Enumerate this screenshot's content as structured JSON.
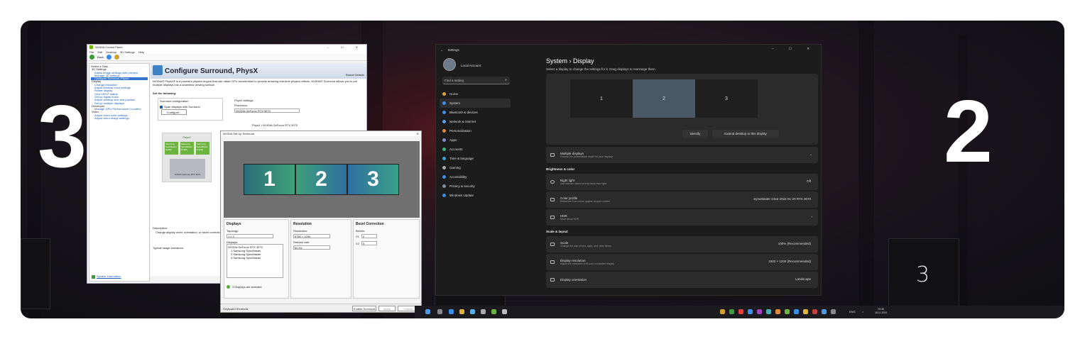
{
  "labels": {
    "left_big": "3",
    "center_big": "1",
    "right_big": "2",
    "box_mid": "2",
    "box_right": "3"
  },
  "nvidia_panel": {
    "title": "NVIDIA Control Panel",
    "menu": [
      "File",
      "Edit",
      "Desktop",
      "3D Settings",
      "Help"
    ],
    "back_label": "Back",
    "task_label": "Select a Task...",
    "tree": [
      "3D Settings",
      "Adjust image settings with preview",
      "Manage 3D settings",
      "Configure Surround, PhysX",
      "Display",
      "Change resolution",
      "Adjust desktop color settings",
      "Rotate display",
      "View HDCP status",
      "Set up digital audio",
      "Adjust desktop size and position",
      "Set up multiple displays",
      "Developer",
      "Manage GPU Performance Counters",
      "Video",
      "Adjust video color settings",
      "Adjust video image settings"
    ],
    "header": "Configure Surround, PhysX",
    "restore": "Restore Defaults",
    "intro": "NVIDIA® PhysX® is a powerful physics engine that can utilize GPU acceleration to provide amazing real-time physics effects. NVIDIA® Surround allows you to put multiple displays into a seamless viewing surface.",
    "set_following": "Set the following:",
    "surround_config": "Surround configuration",
    "span_label": "Span displays with Surround",
    "configure_btn": "Configure...",
    "physx_settings": "PhysX settings",
    "processor_label": "Processor:",
    "processor_value": "NVIDIA GeForce RTX 3070",
    "physx_caption": "PhysX • NVIDIA GeForce RTX 3070",
    "diagram_physx": "PhysX",
    "diagram_gpu": "NVIDIA GeForce RTX 3070",
    "diagram_mon": "Samsung SyncMaster (FullD)",
    "description_label": "Description:",
    "description_text": "Change display order, orientation, or bezel correction.",
    "typical_label": "Typical usage scenarios:",
    "system_info": "System Information"
  },
  "surround_dialog": {
    "title": "NVIDIA Set Up Surround",
    "monitors": [
      "1",
      "2",
      "3"
    ],
    "displays_title": "Displays",
    "topology_label": "Topology:",
    "topology_value": "1 x 3",
    "displays_label": "Displays:",
    "display_list": [
      "NVIDIA GeForce RTX 3070",
      "1.Samsung SyncMaster",
      "2.Samsung SyncMaster",
      "3.Samsung SyncMaster"
    ],
    "status": "3 Displays are selected.",
    "resolution_title": "Resolution",
    "resolution_label": "Resolution:",
    "resolution_value": "5760 × 1200",
    "refresh_label": "Refresh rate:",
    "refresh_value": "60 Hz",
    "bezel_title": "Bezel Correction",
    "bezels_label": "Bezels:",
    "bezel_values": [
      "0",
      "0"
    ],
    "bezel_keys": [
      "V1",
      "V2"
    ],
    "shortcuts": "Keyboard Shortcuts",
    "enable": "Enable Surround",
    "apply": "Apply",
    "cancel": "Cancel"
  },
  "settings": {
    "title": "Settings",
    "account": "Local Account",
    "search_placeholder": "Find a setting",
    "nav": [
      {
        "label": "Home",
        "color": "#e0a040"
      },
      {
        "label": "System",
        "color": "#3a8ee6"
      },
      {
        "label": "Bluetooth & devices",
        "color": "#3a8ee6"
      },
      {
        "label": "Network & internet",
        "color": "#5aa0e8"
      },
      {
        "label": "Personalization",
        "color": "#e08840"
      },
      {
        "label": "Apps",
        "color": "#8888cc"
      },
      {
        "label": "Accounts",
        "color": "#40b080"
      },
      {
        "label": "Time & language",
        "color": "#3aa0d0"
      },
      {
        "label": "Gaming",
        "color": "#aaaaaa"
      },
      {
        "label": "Accessibility",
        "color": "#4090e0"
      },
      {
        "label": "Privacy & security",
        "color": "#8090a0"
      },
      {
        "label": "Windows Update",
        "color": "#3a8ee6"
      }
    ],
    "breadcrumb": "System  ›  Display",
    "hint": "Select a display to change the settings for it. Drag displays to rearrange them.",
    "monitors": [
      "1",
      "2",
      "3"
    ],
    "identify": "Identify",
    "extend": "Extend desktop to this display",
    "multiple": {
      "title": "Multiple displays",
      "sub": "Choose the presentation mode for your displays"
    },
    "brightness_section": "Brightness & color",
    "night": {
      "title": "Night light",
      "sub": "Use warmer colors to help block blue light",
      "value": "Off"
    },
    "color_profile": {
      "title": "Color profile",
      "sub": "Determine how colors appear on your screen",
      "value": "SyncMaster 2443 2022-01-20 RTX 3070"
    },
    "hdr": {
      "title": "HDR",
      "sub": "More about HDR"
    },
    "scale_section": "Scale & layout",
    "scale": {
      "title": "Scale",
      "sub": "Change the size of text, apps, and other items",
      "value": "100% (Recommended)"
    },
    "resolution": {
      "title": "Display resolution",
      "sub": "Adjust the resolution to fit your connected display",
      "value": "1920 × 1200 (Recommended)"
    },
    "orientation": {
      "title": "Display orientation",
      "value": "Landscape"
    }
  },
  "taskbar": {
    "lang": "ENG",
    "time": "09:36",
    "date": "18.11.2024"
  }
}
